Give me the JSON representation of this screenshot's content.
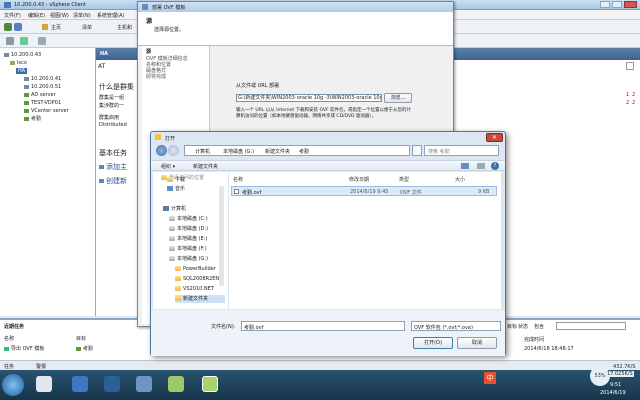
{
  "vsphere": {
    "title": "10.200.0.43 - vSphere Client",
    "menu": [
      "文件(F)",
      "编辑(E)",
      "视图(W)",
      "清单(N)",
      "系统管理(A)"
    ],
    "breadcrumb": [
      "主页",
      "清单",
      "主机和"
    ],
    "tree": [
      "10.200.0.43",
      "Isco",
      "HA",
      "10.200.0.41",
      "10.200.0.51",
      "AD server",
      "TEST-VDP01",
      "VCenter server",
      "考勤"
    ],
    "right_tab": "HA",
    "right_heading": "什么是群集",
    "right_lines": [
      "群集是一组",
      "集涉群的一",
      "群集启用",
      "Distributed"
    ],
    "right_basic_title": "基本任务",
    "right_tasks": [
      "添加主",
      "创建新"
    ],
    "at_label": "AT"
  },
  "tasks_panel": {
    "title": "近期任务",
    "cols": [
      "名称",
      "目标"
    ],
    "row_name": "导出 OVF 模板",
    "row_target": "考勤",
    "right_label1": "目标",
    "right_label2": "状态",
    "right_label3": "包含",
    "right_col": "完成时间",
    "right_time": "2014/6/18 18:48:17",
    "sidebar_numbers": [
      "1",
      "2",
      "2",
      "2"
    ]
  },
  "ovf": {
    "title": "部署 OVF 模板",
    "step_title": "源",
    "step_subtitle": "选择源位置。",
    "steps": [
      "源",
      "OVF 模板详细信息",
      "名称和位置",
      "磁盘格式",
      "即将完成"
    ],
    "from_label": "从文件或 URL 部署",
    "path_value": "G:\\新建文件夹\\WIN2003-oracle 10g -3\\WIN2003-oracle 10g",
    "browse": "浏览...",
    "help": "输入一个 URL 以从 Internet 下载和安装 OVF 软件包，或指定一个位置以便于从您的计算机访问的位置（如本地硬盘驱动器、网络共享或 CD/DVD 驱动器）。"
  },
  "open_dialog": {
    "title": "打开",
    "address": [
      "计算机",
      "本地磁盘 (G:)",
      "新建文件夹",
      "考勤"
    ],
    "search_placeholder": "搜索 考勤",
    "organize": "组织 ▾",
    "new_folder": "新建文件夹",
    "nav": [
      "最近访问的位置",
      "下载",
      "音乐",
      "计算机",
      "本地磁盘 (C:)",
      "本地磁盘 (D:)",
      "本地磁盘 (E:)",
      "本地磁盘 (F:)",
      "本地磁盘 (G:)",
      "PowerBuilder",
      "SQL2008R2EN",
      "VS2010.NET",
      "新建文件夹"
    ],
    "columns": [
      "名称",
      "修改日期",
      "类型",
      "大小"
    ],
    "file": {
      "name": "考勤.ovf",
      "date": "2014/6/19 9:45",
      "type": "OVF 文件",
      "size": "9 KB"
    },
    "filename_label": "文件名(N):",
    "filename_value": "考勤.ovf",
    "filetype": "OVF 软件包 (*.ovf;*.ova)",
    "open_button": "打开(O)",
    "cancel_button": "取消"
  },
  "taskbar": {
    "clock_time": "9:51",
    "clock_date": "2014/6/19",
    "net_up": "432.7K/S",
    "net_down": "17.025K/S",
    "net_percent": "53%",
    "lang": "中",
    "status_left": "任务",
    "status_right": "警报"
  }
}
